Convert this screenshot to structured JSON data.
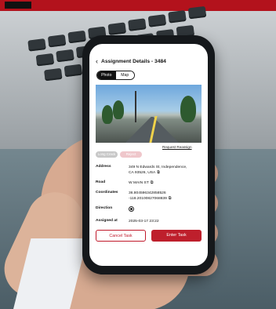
{
  "app": {
    "title": "Assignment Details - 3484",
    "tabs": [
      "Photo",
      "Map"
    ],
    "active_tab": "Photo",
    "request_link": "Request Reassign",
    "chips": [
      "Long Crack",
      "Reject"
    ],
    "details": {
      "address_label": "Address",
      "address_line1": "349 N Edwards St, Independence,",
      "address_line2": "CA 93526, USA",
      "road_label": "Road",
      "road_value": "W MAIN ST",
      "coordinates_label": "Coordinates",
      "lat": "36.804596342858526",
      "lon": "-118.20100827068839",
      "direction_label": "Direction",
      "assigned_label": "Assigned at",
      "assigned_value": "2025-03-17 23:22"
    },
    "buttons": {
      "cancel": "Cancel Task",
      "enter": "Enter Task"
    }
  },
  "colors": {
    "brand_red": "#be1f2c",
    "chip_gray": "#c8c8c8",
    "chip_pink": "#efc7cb"
  },
  "icons": [
    "back-arrow-icon",
    "copy-icon",
    "direction-icon"
  ]
}
